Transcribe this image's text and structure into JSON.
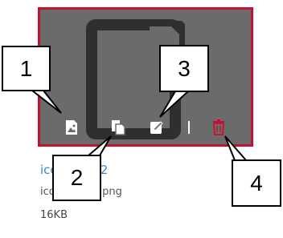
{
  "card": {
    "border_color": "#c8102e",
    "overlay_color": "#6b6b6b",
    "actions": [
      {
        "icon": "image-view-icon"
      },
      {
        "icon": "copy-icon"
      },
      {
        "icon": "edit-icon"
      },
      {
        "icon": "trash-icon",
        "color": "#c8102e"
      }
    ]
  },
  "file": {
    "name": "icon_03_02",
    "filename": "icon_03_02.png",
    "size": "16KB",
    "link_color": "#3a86c8"
  },
  "callouts": [
    "1",
    "2",
    "3",
    "4"
  ]
}
